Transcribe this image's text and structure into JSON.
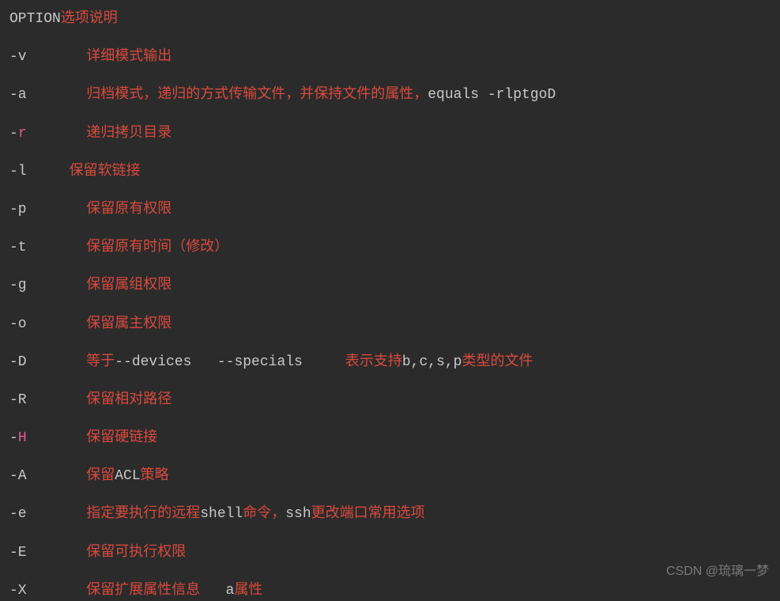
{
  "lines": [
    {
      "segments": [
        {
          "text": "OPTION",
          "cls": "white"
        },
        {
          "text": "选项说明",
          "cls": "red"
        }
      ]
    },
    {
      "segments": [
        {
          "text": "-v       ",
          "cls": "white"
        },
        {
          "text": "详细模式输出",
          "cls": "red"
        }
      ]
    },
    {
      "segments": [
        {
          "text": "-a       ",
          "cls": "white"
        },
        {
          "text": "归档模式，递归的方式传输文件，并保持文件的属性，",
          "cls": "red"
        },
        {
          "text": "equals -rlptgoD",
          "cls": "white"
        }
      ]
    },
    {
      "segments": [
        {
          "text": "-",
          "cls": "white"
        },
        {
          "text": "r",
          "cls": "pink"
        },
        {
          "text": "       ",
          "cls": "white"
        },
        {
          "text": "递归拷贝目录",
          "cls": "red"
        }
      ]
    },
    {
      "segments": [
        {
          "text": "-l     ",
          "cls": "white"
        },
        {
          "text": "保留软链接",
          "cls": "red"
        }
      ]
    },
    {
      "segments": [
        {
          "text": "-p       ",
          "cls": "white"
        },
        {
          "text": "保留原有权限",
          "cls": "red"
        }
      ]
    },
    {
      "segments": [
        {
          "text": "-t       ",
          "cls": "white"
        },
        {
          "text": "保留原有时间（修改）",
          "cls": "red"
        }
      ]
    },
    {
      "segments": [
        {
          "text": "-g       ",
          "cls": "white"
        },
        {
          "text": "保留属组权限",
          "cls": "red"
        }
      ]
    },
    {
      "segments": [
        {
          "text": "-o       ",
          "cls": "white"
        },
        {
          "text": "保留属主权限",
          "cls": "red"
        }
      ]
    },
    {
      "segments": [
        {
          "text": "-D       ",
          "cls": "white"
        },
        {
          "text": "等于",
          "cls": "red"
        },
        {
          "text": "--devices   --specials     ",
          "cls": "white"
        },
        {
          "text": "表示支持",
          "cls": "red"
        },
        {
          "text": "b,c,s,p",
          "cls": "white"
        },
        {
          "text": "类型的文件",
          "cls": "red"
        }
      ]
    },
    {
      "segments": [
        {
          "text": "-R       ",
          "cls": "white"
        },
        {
          "text": "保留相对路径",
          "cls": "red"
        }
      ]
    },
    {
      "segments": [
        {
          "text": "-",
          "cls": "white"
        },
        {
          "text": "H",
          "cls": "pink"
        },
        {
          "text": "       ",
          "cls": "white"
        },
        {
          "text": "保留硬链接",
          "cls": "red"
        }
      ]
    },
    {
      "segments": [
        {
          "text": "-A       ",
          "cls": "white"
        },
        {
          "text": "保留",
          "cls": "red"
        },
        {
          "text": "ACL",
          "cls": "white"
        },
        {
          "text": "策略",
          "cls": "red"
        }
      ]
    },
    {
      "segments": [
        {
          "text": "-e       ",
          "cls": "white"
        },
        {
          "text": "指定要执行的远程",
          "cls": "red"
        },
        {
          "text": "shell",
          "cls": "white"
        },
        {
          "text": "命令，",
          "cls": "red"
        },
        {
          "text": "ssh",
          "cls": "white"
        },
        {
          "text": "更改端口常用选项",
          "cls": "red"
        }
      ]
    },
    {
      "segments": [
        {
          "text": "-E       ",
          "cls": "white"
        },
        {
          "text": "保留可执行权限",
          "cls": "red"
        }
      ]
    },
    {
      "segments": [
        {
          "text": "-X       ",
          "cls": "white"
        },
        {
          "text": "保留扩展属性信息   ",
          "cls": "red"
        },
        {
          "text": "a",
          "cls": "white"
        },
        {
          "text": "属性",
          "cls": "red"
        }
      ]
    }
  ],
  "watermark": "CSDN @琉璃一梦"
}
